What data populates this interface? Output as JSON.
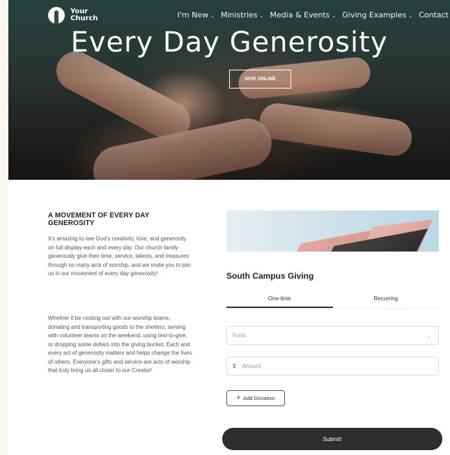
{
  "brand": {
    "name": "Your\nChurch"
  },
  "nav": {
    "items": [
      {
        "label": "I'm New",
        "has_dropdown": true
      },
      {
        "label": "Ministries",
        "has_dropdown": true
      },
      {
        "label": "Media & Events",
        "has_dropdown": true
      },
      {
        "label": "Giving Examples",
        "has_dropdown": true
      },
      {
        "label": "Contact",
        "has_dropdown": false
      }
    ],
    "dropdown_glyph": "⌄"
  },
  "hero": {
    "title": "Every Day Generosity",
    "button_label": "GIVE ONLINE"
  },
  "intro": {
    "heading": "A MOVEMENT OF EVERY DAY GENEROSITY",
    "paragraph_1": "It's amazing to see God's creativity, love, and generosity on full display each and every day. Our church family generously give their time, service, talents, and treasures through so many acts of worship, and we invite you to join us in our movement of every day generosity!",
    "paragraph_2": "Whether it be rocking out with our worship teams, donating and transporting goods to the shelters, serving with volunteer teams on the weekend, using text-to-give, or dropping some dollars into the giving bucket. Each and every act of generosity matters and helps change the lives of others. Everyone's gifts and service are acts of worship that truly bring us all closer to our Creator!"
  },
  "giving_form": {
    "title": "South Campus Giving",
    "tabs": [
      {
        "label": "One-time",
        "active": true
      },
      {
        "label": "Recurring",
        "active": false
      }
    ],
    "fund_placeholder": "Fund",
    "currency_symbol": "$",
    "amount_placeholder": "Amount",
    "add_donation_label": "Add Donation",
    "submit_label": "Submit!"
  },
  "icons": {
    "logo": "church-logo-icon",
    "chevron": "chevron-down-icon",
    "plus": "plus-icon"
  },
  "colors": {
    "page_background": "#fdf8ef",
    "nav_overlay": "#2f4a45",
    "submit_button": "#2e2e2e"
  }
}
